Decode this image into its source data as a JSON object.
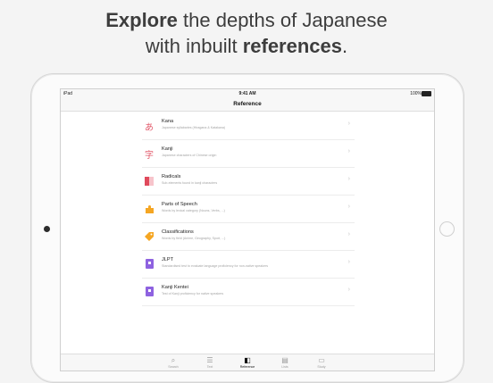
{
  "headline": {
    "line1_bold": "Explore",
    "line1_rest": " the depths of Japanese",
    "line2_start": "with inbuilt ",
    "line2_bold": "references",
    "line2_end": "."
  },
  "status_bar": {
    "device": "iPad",
    "time": "9:41 AM",
    "battery": "100%"
  },
  "nav": {
    "title": "Reference"
  },
  "rows": [
    {
      "title": "Kana",
      "subtitle": "Japanese syllabaries (Hiragana & Katakana)",
      "icon": "hiragana-a-icon",
      "glyph": "あ"
    },
    {
      "title": "Kanji",
      "subtitle": "Japanese characters of Chinese origin",
      "icon": "kanji-ji-icon",
      "glyph": "字"
    },
    {
      "title": "Radicals",
      "subtitle": "Sub-elements found in kanji characters",
      "icon": "radicals-icon"
    },
    {
      "title": "Parts of Speech",
      "subtitle": "Words by lexical category (Nouns, Verbs, ...)",
      "icon": "puzzle-icon"
    },
    {
      "title": "Classifications",
      "subtitle": "Words by field (Anime, Geography, Sport, ...)",
      "icon": "tag-icon"
    },
    {
      "title": "JLPT",
      "subtitle": "Standardised test to evaluate language proficiency for non-native speakers",
      "icon": "jlpt-book-icon"
    },
    {
      "title": "Kanji Kentei",
      "subtitle": "Test of Kanji proficiency for native speakers",
      "icon": "kentei-book-icon"
    }
  ],
  "tabs": [
    {
      "label": "Search",
      "icon": "search-icon",
      "glyph": "⌕"
    },
    {
      "label": "Text",
      "icon": "text-icon",
      "glyph": "☰"
    },
    {
      "label": "Reference",
      "icon": "reference-icon",
      "glyph": "◧",
      "active": true
    },
    {
      "label": "Lists",
      "icon": "lists-icon",
      "glyph": "▤"
    },
    {
      "label": "Study",
      "icon": "study-icon",
      "glyph": "▭"
    }
  ],
  "colors": {
    "accent_red": "#e25b6c",
    "accent_orange": "#f5a623",
    "accent_purple": "#8e62e0"
  }
}
